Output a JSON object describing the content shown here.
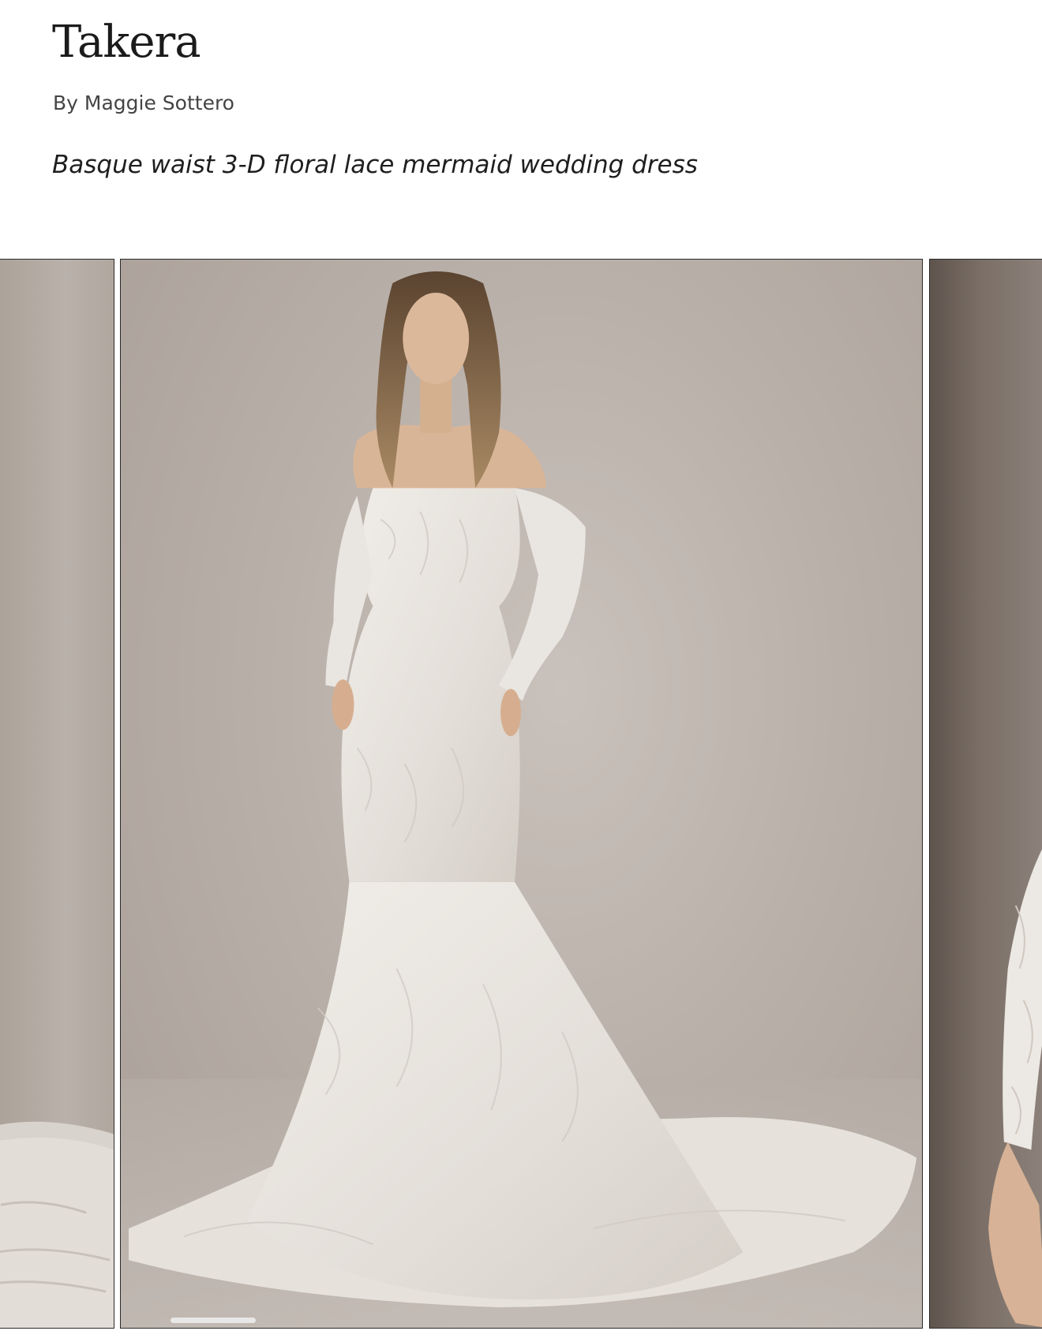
{
  "product": {
    "name": "Takera",
    "designer": "By Maggie Sottero",
    "tagline": "Basque waist 3-D floral lace mermaid wedding dress"
  },
  "gallery": {
    "favorite_icon": "heart-outline-icon",
    "slides": [
      {
        "id": "previous",
        "label": ""
      },
      {
        "id": "current",
        "label": ""
      },
      {
        "id": "next",
        "label": ""
      }
    ]
  },
  "colors": {
    "background": "#ffffff",
    "text": "#1a1a1a",
    "photo_backdrop": "#b9b0a9",
    "dress": "#ebe7e2"
  }
}
